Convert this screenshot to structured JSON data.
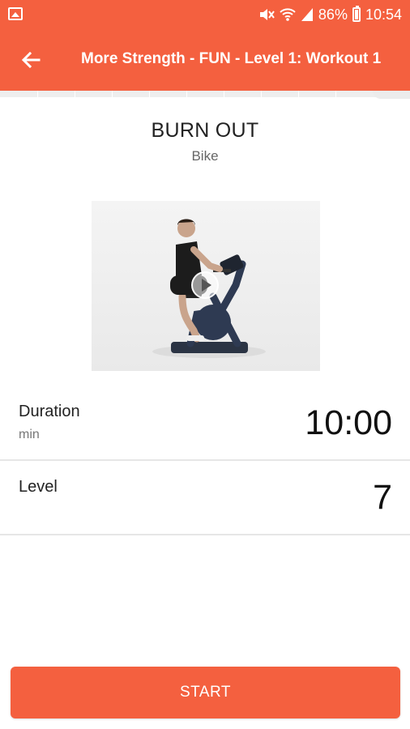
{
  "status_bar": {
    "battery": "86%",
    "time": "10:54"
  },
  "app_bar": {
    "title": "More Strength - FUN - Level 1: Workout 1"
  },
  "exercise": {
    "title": "BURN OUT",
    "equipment": "Bike"
  },
  "settings": {
    "duration_label": "Duration",
    "duration_unit": "min",
    "duration_value": "10:00",
    "level_label": "Level",
    "level_value": "7"
  },
  "actions": {
    "start_label": "START"
  },
  "colors": {
    "accent": "#f4603f"
  },
  "icons": [
    "gallery-icon",
    "mute-icon",
    "wifi-icon",
    "signal-icon",
    "battery-icon",
    "back-arrow-icon",
    "play-icon"
  ]
}
